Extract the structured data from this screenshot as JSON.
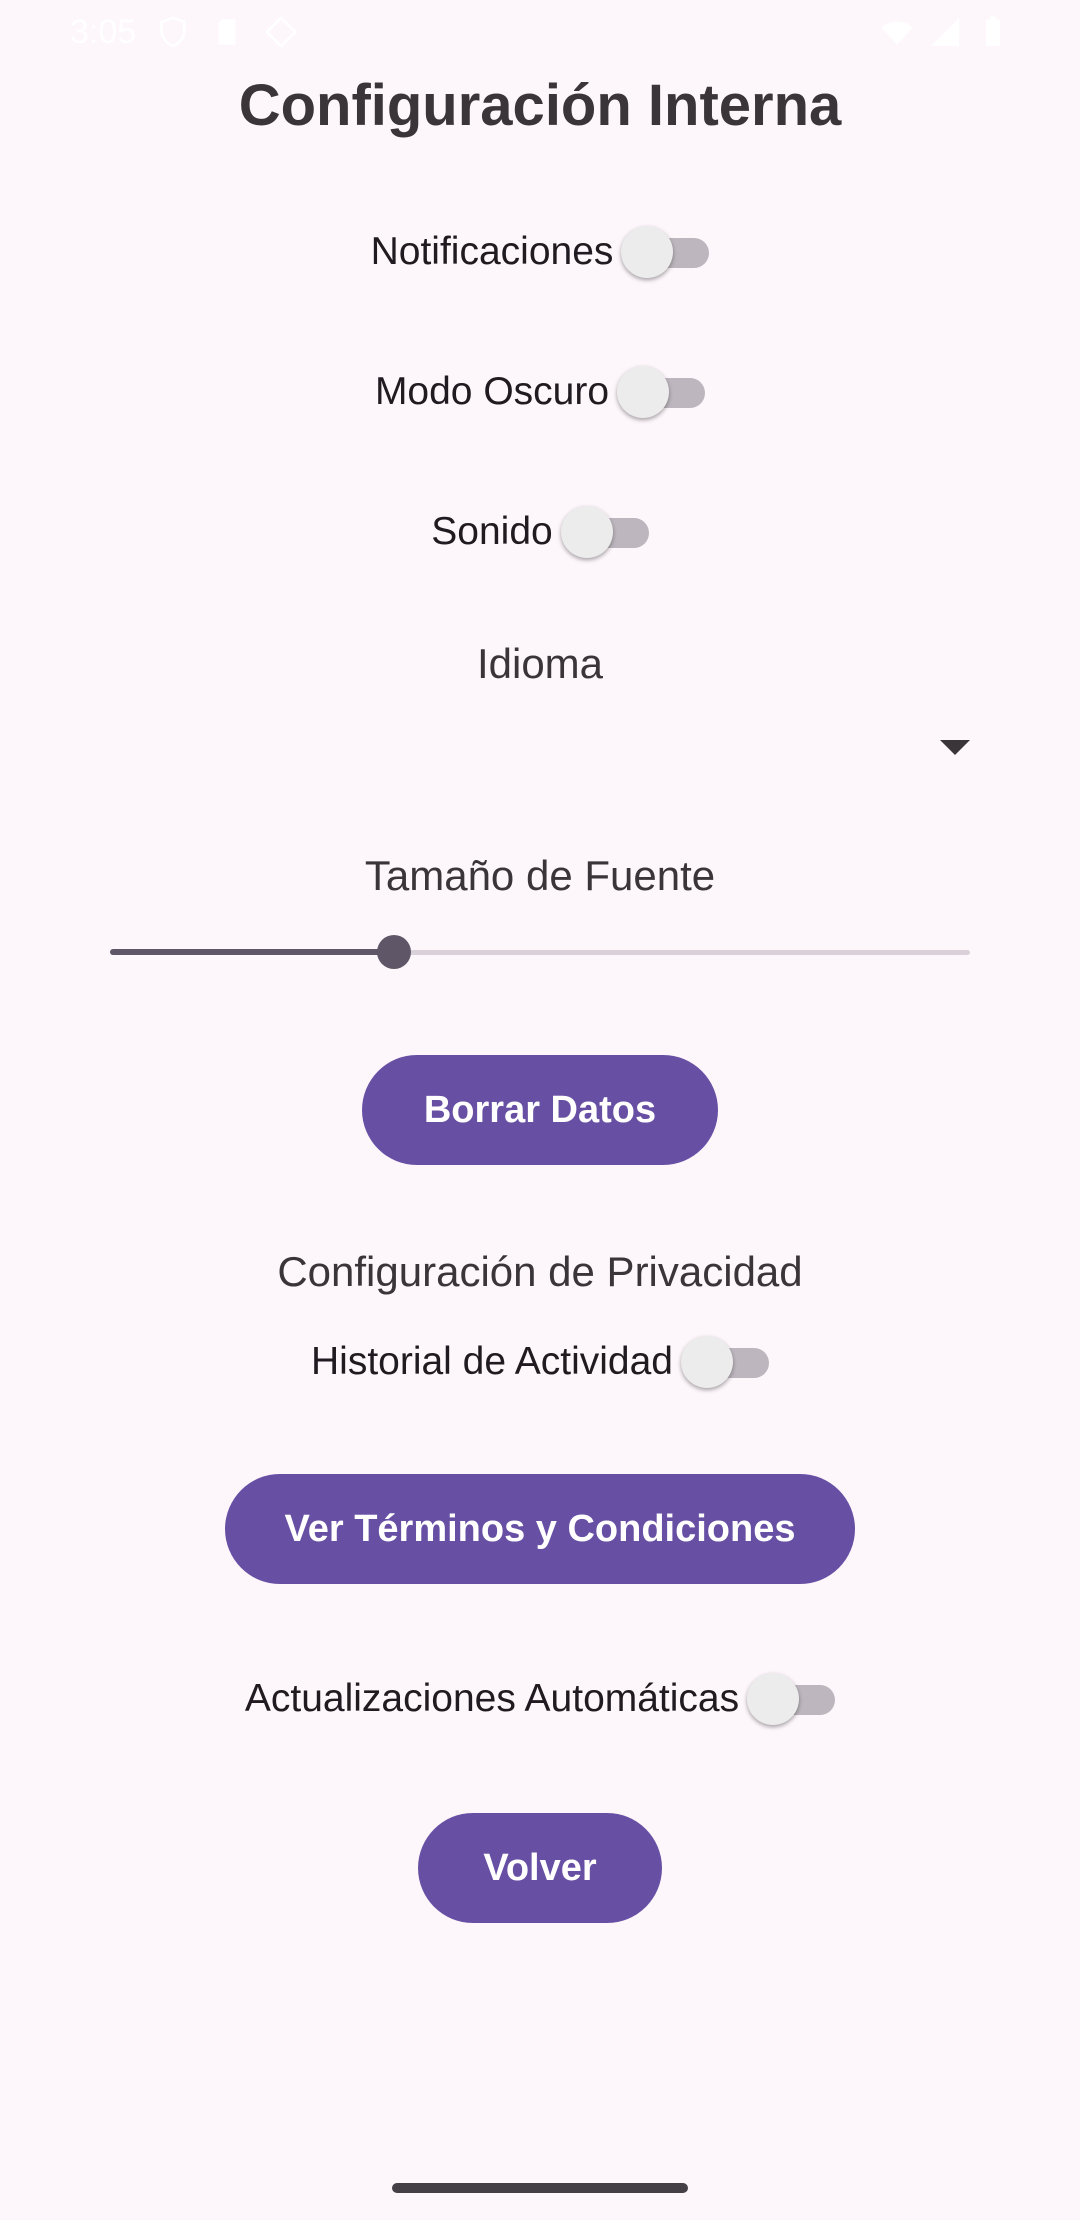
{
  "status_bar": {
    "time": "3:05",
    "icons": [
      "shield-icon",
      "sd-card-icon",
      "location-icon",
      "wifi-icon",
      "signal-icon",
      "battery-icon"
    ]
  },
  "title": "Configuración Interna",
  "toggles": {
    "notificaciones": {
      "label": "Notificaciones",
      "on": false
    },
    "modo_oscuro": {
      "label": "Modo Oscuro",
      "on": false
    },
    "sonido": {
      "label": "Sonido",
      "on": false
    },
    "historial": {
      "label": "Historial de Actividad",
      "on": false
    },
    "actualizaciones": {
      "label": "Actualizaciones Automáticas",
      "on": false
    }
  },
  "idioma": {
    "label": "Idioma",
    "selected": ""
  },
  "font_size": {
    "label": "Tamaño de Fuente",
    "fraction": 0.33
  },
  "buttons": {
    "borrar": "Borrar Datos",
    "terminos": "Ver Términos y Condiciones",
    "volver": "Volver"
  },
  "privacy": {
    "heading": "Configuración de Privacidad"
  },
  "colors": {
    "background": "#fdf6fb",
    "primary": "#6750a4",
    "switch_track_off": "#bdb6be",
    "slider_active": "#5f5767"
  }
}
